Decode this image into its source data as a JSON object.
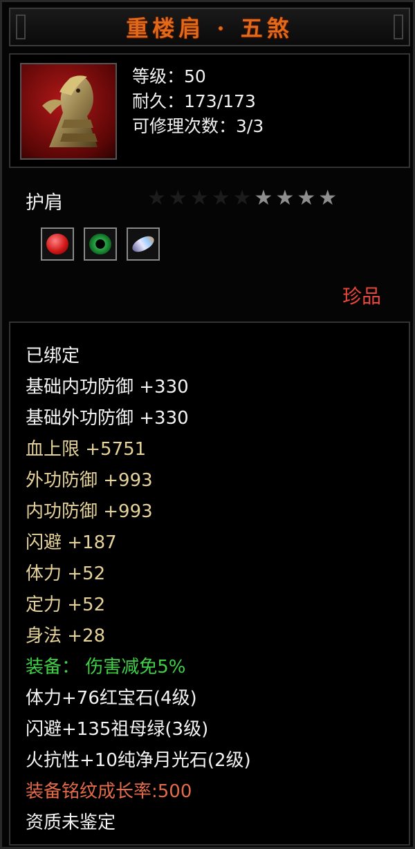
{
  "title": "重楼肩 · 五煞",
  "item": {
    "icon": "dragon-shoulder-icon",
    "level": "等级：50",
    "durability": "耐久：173/173",
    "repairs": "可修理次数：3/3"
  },
  "type": "护肩",
  "stars": {
    "filled": 4,
    "total": 9
  },
  "gems": [
    "ruby-gem-icon",
    "emerald-gem-icon",
    "moonstone-gem-icon"
  ],
  "rarity": "珍品",
  "attributes": {
    "bound": "已绑定",
    "base_inner_def": "基础内功防御 +330",
    "base_outer_def": "基础外功防御 +330",
    "max_hp": "血上限 +5751",
    "outer_def": "外功防御 +993",
    "inner_def": "内功防御 +993",
    "dodge": "闪避 +187",
    "stamina": "体力 +52",
    "concentration": "定力 +52",
    "agility": "身法 +28",
    "equip_effect": "装备： 伤害减免5%",
    "gem1": "体力+76红宝石(4级)",
    "gem2": "闪避+135祖母绿(3级)",
    "gem3": "火抗性+10纯净月光石(2级)",
    "inscription": "装备铭纹成长率:500",
    "aptitude": "资质未鉴定"
  },
  "colors": {
    "title": "#e06a1a",
    "tan": "#e6d39a",
    "green": "#3fd145",
    "orange": "#e56a4a",
    "rarity": "#e8463a"
  }
}
